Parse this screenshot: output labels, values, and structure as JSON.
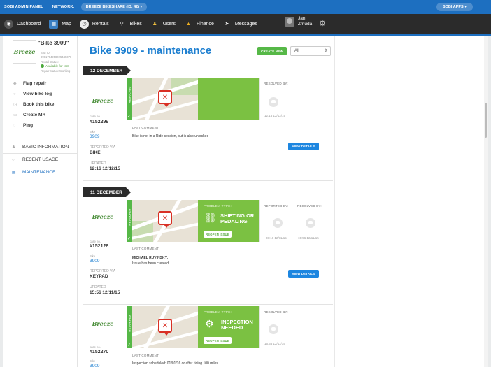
{
  "topbar": {
    "admin_panel": "SOBI ADMIN PANEL",
    "network_label": "NETWORK:",
    "network_value": "BREEZE BIKESHARE (ID: 42) ▾",
    "apps": "SOBI APPS ▾"
  },
  "nav": {
    "items": [
      {
        "label": "Dashboard",
        "icon": "dashboard-icon"
      },
      {
        "label": "Map",
        "icon": "map-icon"
      },
      {
        "label": "Rentals",
        "icon": "rentals-icon"
      },
      {
        "label": "Bikes",
        "icon": "bikes-icon"
      },
      {
        "label": "Users",
        "icon": "users-icon"
      },
      {
        "label": "Finance",
        "icon": "finance-icon"
      },
      {
        "label": "Messages",
        "icon": "messages-icon"
      }
    ],
    "user_first": "Jan",
    "user_last": "Zmuda"
  },
  "sidebar": {
    "logo": "Breeze",
    "bike_title": "\"Bike 3909\"",
    "sim_label": "SIM ID:",
    "sim_value": "8991704258025449376",
    "rental_status": "Rental status:",
    "availability": "Available for rent",
    "repair_status": "Repair status: Working",
    "actions": [
      "Flag repair",
      "View bike log",
      "Book this bike",
      "Create MR",
      "Ping"
    ],
    "sections": [
      "BASIC INFORMATION",
      "RECENT USAGE",
      "MAINTENANCE"
    ]
  },
  "header": {
    "title": "Bike 3909 - maintenance",
    "create_label": "CREATE NEW",
    "filter_value": "All"
  },
  "dates": [
    "12 DECEMBER",
    "11 DECEMBER"
  ],
  "cases": [
    {
      "case_label": "case no.",
      "case_no": "#152299",
      "bike_label": "Bike",
      "bike": "3909",
      "reported_label": "REPORTED VIA",
      "reported": "BIKE",
      "updated_label": "UPDATED",
      "updated": "12:16 12/12/15",
      "resolved_tab": "RESOLVED",
      "resolved_by_label": "RESOLVED BY:",
      "resolved_time": "12:16 12/12/15",
      "comment_label": "LAST COMMENT:",
      "comment_text": "Bike is not in a Ride session, but is also unlocked",
      "view_label": "VIEW DETAILS"
    },
    {
      "case_label": "case no.",
      "case_no": "#152128",
      "bike_label": "Bike",
      "bike": "3909",
      "reported_label": "REPORTED VIA",
      "reported": "KEYPAD",
      "updated_label": "UPDATED",
      "updated": "15:56 12/11/15",
      "resolved_tab": "RESOLVED",
      "problem_label": "PROBLEM TYPE:",
      "problem_name_1": "SHIFTING OR",
      "problem_name_2": "PEDALING",
      "reopen_label": "REOPEN ISSUE",
      "reported_by_label": "REPORTED BY:",
      "reported_time": "08:16 12/11/15",
      "resolved_by_label": "RESOLVED BY:",
      "resolved_time": "15:56 12/11/15",
      "comment_label": "LAST COMMENT:",
      "comment_author": "MICHAEL RUVINSKY:",
      "comment_text": "Issue has been created",
      "view_label": "VIEW DETAILS"
    },
    {
      "case_label": "case no.",
      "case_no": "#152270",
      "bike_label": "Bike",
      "bike": "3909",
      "resolved_tab": "RESOLVED",
      "problem_label": "PROBLEM TYPE:",
      "problem_name_1": "INSPECTION",
      "problem_name_2": "NEEDED",
      "reopen_label": "REOPEN ISSUE",
      "resolved_by_label": "RESOLVED BY:",
      "resolved_time": "15:56 12/11/15",
      "comment_label": "LAST COMMENT:",
      "comment_text": "Inspection scheduled: 01/01/16 or after riding 100 miles"
    }
  ]
}
